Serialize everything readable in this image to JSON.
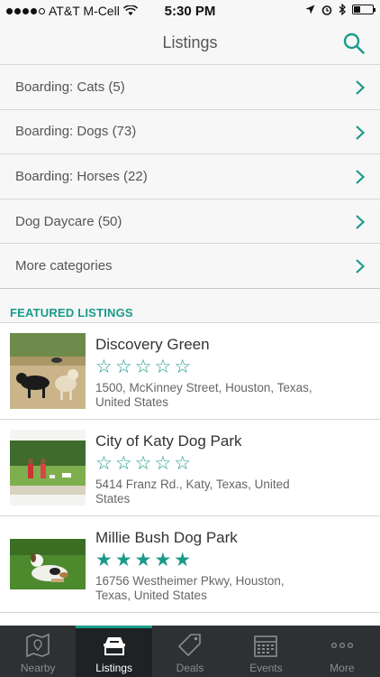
{
  "status_bar": {
    "carrier": "AT&T M-Cell",
    "time": "5:30 PM"
  },
  "nav": {
    "title": "Listings"
  },
  "categories": [
    {
      "label": "Boarding: Cats (5)"
    },
    {
      "label": "Boarding: Dogs (73)"
    },
    {
      "label": "Boarding: Horses (22)"
    },
    {
      "label": "Dog Daycare (50)"
    },
    {
      "label": "More categories"
    }
  ],
  "featured": {
    "heading": "FEATURED LISTINGS",
    "items": [
      {
        "name": "Discovery Green",
        "rating": 0,
        "stars": "☆☆☆☆☆",
        "address": "1500, McKinney Street, Houston, Texas, United States"
      },
      {
        "name": "City of Katy Dog Park",
        "rating": 0,
        "stars": "☆☆☆☆☆",
        "address": "5414 Franz Rd., Katy, Texas, United States"
      },
      {
        "name": "Millie Bush Dog Park",
        "rating": 5,
        "stars": "★★★★★",
        "address": "16756 Westheimer Pkwy, Houston, Texas, United States"
      }
    ]
  },
  "tabs": [
    {
      "label": "Nearby",
      "icon": "map-icon"
    },
    {
      "label": "Listings",
      "icon": "listings-icon",
      "active": true
    },
    {
      "label": "Deals",
      "icon": "tag-icon"
    },
    {
      "label": "Events",
      "icon": "calendar-icon"
    },
    {
      "label": "More",
      "icon": "more-icon"
    }
  ],
  "colors": {
    "accent": "#1a9b8a",
    "tab_bar": "#2e3134"
  }
}
